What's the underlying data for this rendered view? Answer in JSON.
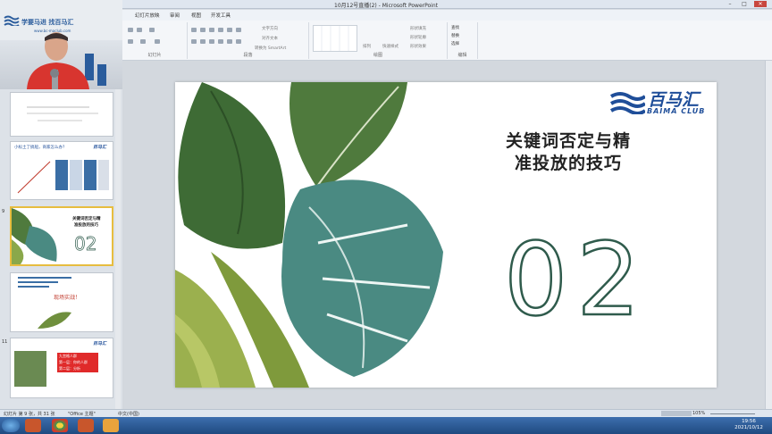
{
  "window": {
    "title": "10月12号直播(2) - Microsoft PowerPoint",
    "minimize": "–",
    "maximize": "□",
    "close": "✕"
  },
  "tabs": [
    "幻灯片放映",
    "审阅",
    "视图",
    "开发工具"
  ],
  "ribbon": {
    "groups": [
      "幻灯片",
      "段落",
      "绘图",
      "编辑"
    ],
    "labels": {
      "text_direction": "文字方向",
      "align_text": "对齐文本",
      "smartart": "转换为 SmartArt",
      "arrange": "排列",
      "quick_styles": "快速样式",
      "shape_fill": "形状填充",
      "shape_outline": "形状轮廓",
      "shape_effects": "形状效果",
      "find": "查找",
      "replace": "替换",
      "select": "选择"
    }
  },
  "webcam": {
    "logo_text": "学要马进  找百马汇",
    "url": "www.bc-maclub.com"
  },
  "thumbnails": [
    {
      "number": "",
      "texts": []
    },
    {
      "number": "",
      "texts": [
        "小标土了搞船，商家怎么办？"
      ]
    },
    {
      "number": "9",
      "texts": [
        "关键词否定与精",
        "准投放的技巧",
        "02"
      ]
    },
    {
      "number": "",
      "texts": [
        "现场实战！"
      ]
    },
    {
      "number": "11",
      "texts": [
        "九宫格人群",
        "第一层：你的人群",
        "第二层：分析"
      ]
    }
  ],
  "slide": {
    "title_line1": "关键词否定与精",
    "title_line2": "准投放的技巧",
    "section_number": "02",
    "brand_cn": "百马汇",
    "brand_en": "BAIMA CLUB"
  },
  "statusbar": {
    "slide_info": "幻灯片 第 9 张，共 31 张",
    "theme": "\"Office 主题\"",
    "language": "中文(中国)",
    "zoom": "105%"
  },
  "taskbar": {
    "time": "19:56",
    "date": "2021/10/12"
  },
  "colors": {
    "brand_blue": "#1f4e99",
    "number_stroke": "#2f5b4c",
    "leaf_dark": "#3e6b35",
    "leaf_teal": "#4a8a82"
  }
}
